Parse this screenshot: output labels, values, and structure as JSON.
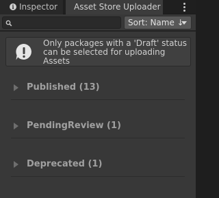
{
  "tabs": {
    "inspector_label": "Inspector",
    "asset_store_uploader_label": "Asset Store Uploader"
  },
  "toolbar": {
    "search_value": "",
    "sort_label": "Sort: Name ↓"
  },
  "help": {
    "message": "Only packages with a 'Draft' status can be selected for uploading Assets"
  },
  "sections": [
    {
      "label": "Published (13)"
    },
    {
      "label": "PendingReview (1)"
    },
    {
      "label": "Deprecated (1)"
    }
  ],
  "icons": {
    "info": "info-icon",
    "menu": "kebab-menu-icon",
    "search": "search-icon",
    "warning": "warning-icon",
    "foldout": "foldout-arrow-icon"
  },
  "colors": {
    "background": "#383838",
    "active_tab": "#3c3c3c",
    "helpbox": "#404040",
    "sort_button": "#585858"
  }
}
